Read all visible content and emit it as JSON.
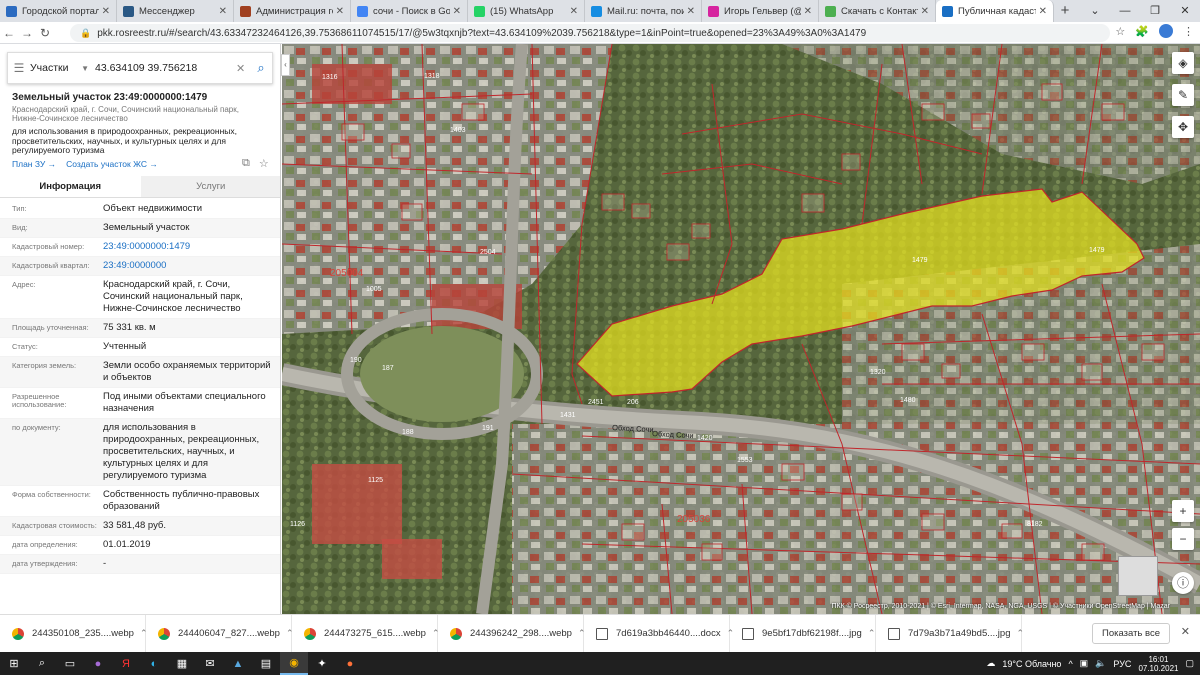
{
  "browser": {
    "tabs": [
      {
        "title": "Городской портал Со",
        "icon": "site-icon",
        "color": "#2c6bc0",
        "active": false
      },
      {
        "title": "Мессенджер",
        "icon": "messenger-icon",
        "color": "#2a5885",
        "active": false
      },
      {
        "title": "Администрация горо",
        "icon": "site-icon",
        "color": "#a04020",
        "active": false
      },
      {
        "title": "сочи - Поиск в Googl",
        "icon": "google-icon",
        "color": "#4285f4",
        "active": false
      },
      {
        "title": "(15) WhatsApp",
        "icon": "whatsapp-icon",
        "color": "#25d366",
        "active": false
      },
      {
        "title": "Mail.ru: почта, поиск",
        "icon": "mail-icon",
        "color": "#168de2",
        "active": false
      },
      {
        "title": "Игорь Гельвер (@igo",
        "icon": "instagram-icon",
        "color": "#d6249f",
        "active": false
      },
      {
        "title": "Скачать с Контакта, К",
        "icon": "download-icon",
        "color": "#4caf50",
        "active": false
      },
      {
        "title": "Публичная кадастр",
        "icon": "rosreestr-icon",
        "color": "#1a6fc4",
        "active": true
      }
    ],
    "new_tab": "+",
    "url": "pkk.rosreestr.ru/#/search/43.63347232464126,39.75368611074515/17/@5w3tqxnjb?text=43.634109%2039.756218&type=1&inPoint=true&opened=23%3A49%3A0%3A1479"
  },
  "search": {
    "type_label": "Участки",
    "query": "43.634109 39.756218"
  },
  "parcel": {
    "title": "Земельный участок 23:49:0000000:1479",
    "address": "Краснодарский край, г. Сочи, Сочинский национальный парк, Нижне-Сочинское лесничество",
    "purpose": "для использования в природоохранных, рекреационных, просветительских, научных, и культурных целях и для регулируемого туризма",
    "link_plan": "План ЗУ →",
    "link_create": "Создать участок ЖС →"
  },
  "info_tabs": {
    "info": "Информация",
    "services": "Услуги"
  },
  "fields": [
    {
      "label": "Тип:",
      "value": "Объект недвижимости",
      "link": false
    },
    {
      "label": "Вид:",
      "value": "Земельный участок",
      "link": false
    },
    {
      "label": "Кадастровый номер:",
      "value": "23:49:0000000:1479",
      "link": true
    },
    {
      "label": "Кадастровый квартал:",
      "value": "23:49:0000000",
      "link": true
    },
    {
      "label": "Адрес:",
      "value": "Краснодарский край, г. Сочи, Сочинский национальный парк, Нижне-Сочинское лесничество",
      "link": false
    },
    {
      "label": "Площадь уточненная:",
      "value": "75 331 кв. м",
      "link": false
    },
    {
      "label": "Статус:",
      "value": "Учтенный",
      "link": false
    },
    {
      "label": "Категория земель:",
      "value": "Земли особо охраняемых территорий и объектов",
      "link": false
    },
    {
      "label": "Разрешенное использование:",
      "value": "Под иными объектами специального назначения",
      "link": false
    },
    {
      "label": "по документу:",
      "value": "для использования в природоохранных, рекреационных, просветительских, научных, и культурных целях и для регулируемого туризма",
      "link": false
    },
    {
      "label": "Форма собственности:",
      "value": "Собственность публично-правовых образований",
      "link": false
    },
    {
      "label": "Кадастровая стоимость:",
      "value": "33 581,48 руб.",
      "link": false
    },
    {
      "label": "дата определения:",
      "value": "01.01.2019",
      "link": false
    },
    {
      "label": "дата утверждения:",
      "value": "-",
      "link": false
    }
  ],
  "map": {
    "parcel_label": "1479",
    "quarter_label_1": "205004",
    "quarter_label_2": "205036",
    "road_label": "Обход Сочи",
    "labels": [
      "187",
      "188",
      "190",
      "191",
      "1431",
      "2451",
      "206",
      "1420",
      "1480",
      "8182",
      "1316",
      "1318",
      "1403",
      "1005",
      "2504",
      "1320",
      "1553",
      "1125",
      "1126"
    ],
    "attribution": "ПКК © Росреестр, 2010-2021 | © Esri, Intermap, NASA, NGA, USGS | © Участники OpenStreetMap | Mazar",
    "zoom_in": "+",
    "zoom_out": "−",
    "highlight_color": "#e6e21e",
    "boundary_color": "#c0262b"
  },
  "downloads": [
    {
      "name": "244350108_235....webp",
      "type": "chrome"
    },
    {
      "name": "244406047_827....webp",
      "type": "chrome"
    },
    {
      "name": "244473275_615....webp",
      "type": "chrome"
    },
    {
      "name": "244396242_298....webp",
      "type": "chrome"
    },
    {
      "name": "7d619a3bb46440....docx",
      "type": "doc"
    },
    {
      "name": "9e5bf17dbf62198f....jpg",
      "type": "img"
    },
    {
      "name": "7d79a3b71a49bd5....jpg",
      "type": "img"
    }
  ],
  "downloads_show_all": "Показать все",
  "taskbar": {
    "weather": "19°C  Облачно",
    "lang": "РУС",
    "time": "16:01",
    "date": "07.10.2021"
  }
}
